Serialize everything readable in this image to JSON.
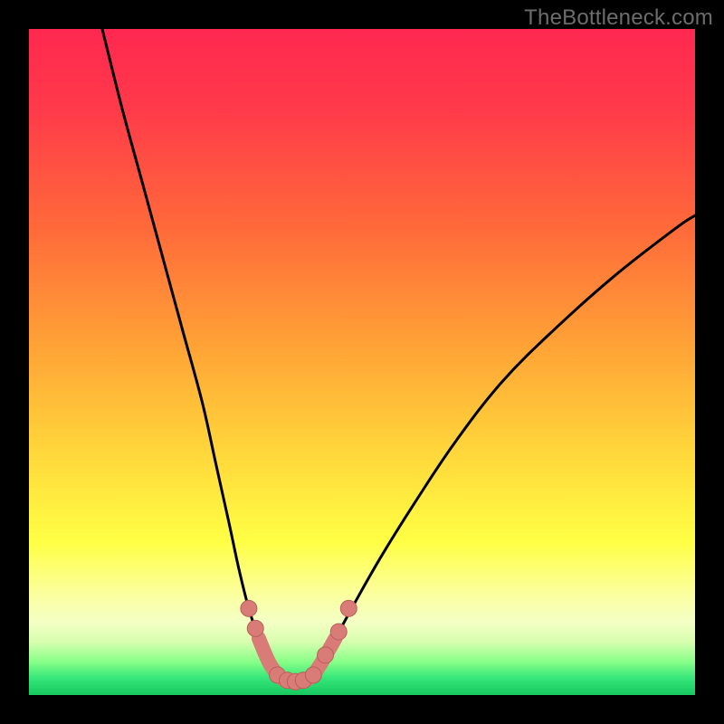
{
  "watermark": "TheBottleneck.com",
  "colors": {
    "frame": "#000000",
    "curve_stroke": "#000000",
    "marker_fill": "#d97b77",
    "marker_stroke": "#b85f5b",
    "gradient_stops": [
      {
        "offset": 0.0,
        "color": "#ff2850"
      },
      {
        "offset": 0.12,
        "color": "#ff3a4a"
      },
      {
        "offset": 0.3,
        "color": "#ff6a3a"
      },
      {
        "offset": 0.48,
        "color": "#ffa436"
      },
      {
        "offset": 0.62,
        "color": "#ffd23a"
      },
      {
        "offset": 0.77,
        "color": "#ffff44"
      },
      {
        "offset": 0.85,
        "color": "#fbffa0"
      },
      {
        "offset": 0.89,
        "color": "#f4ffc4"
      },
      {
        "offset": 0.92,
        "color": "#d8ffb0"
      },
      {
        "offset": 0.95,
        "color": "#88ff88"
      },
      {
        "offset": 0.975,
        "color": "#35e67a"
      },
      {
        "offset": 1.0,
        "color": "#16c85e"
      }
    ]
  },
  "chart_data": {
    "type": "line",
    "title": "",
    "xlabel": "",
    "ylabel": "",
    "xlim": [
      0,
      100
    ],
    "ylim": [
      0,
      100
    ],
    "series": [
      {
        "name": "left-branch",
        "x": [
          11,
          14,
          17,
          20,
          23,
          26,
          28,
          30,
          31.5,
          33,
          34.5,
          36,
          37.3
        ],
        "y": [
          100,
          88,
          77,
          66,
          55,
          44,
          35,
          26,
          19,
          13,
          8.5,
          5,
          3
        ]
      },
      {
        "name": "right-branch",
        "x": [
          42.7,
          44,
          46,
          49,
          53,
          58,
          64,
          71,
          79,
          88,
          97,
          100
        ],
        "y": [
          3,
          5,
          8.5,
          14,
          21,
          29,
          38,
          47,
          55,
          63,
          70,
          72
        ]
      },
      {
        "name": "valley-floor",
        "x": [
          37.3,
          38.5,
          40,
          41.5,
          42.7
        ],
        "y": [
          3,
          2.2,
          2,
          2.2,
          3
        ]
      }
    ],
    "markers": [
      {
        "x": 33.0,
        "y": 13.0
      },
      {
        "x": 34.0,
        "y": 10.0
      },
      {
        "x": 37.3,
        "y": 3.0
      },
      {
        "x": 38.8,
        "y": 2.2
      },
      {
        "x": 40.0,
        "y": 2.0
      },
      {
        "x": 41.2,
        "y": 2.2
      },
      {
        "x": 42.7,
        "y": 3.0
      },
      {
        "x": 44.5,
        "y": 6.0
      },
      {
        "x": 46.5,
        "y": 9.5
      },
      {
        "x": 48.0,
        "y": 13.0
      }
    ]
  }
}
